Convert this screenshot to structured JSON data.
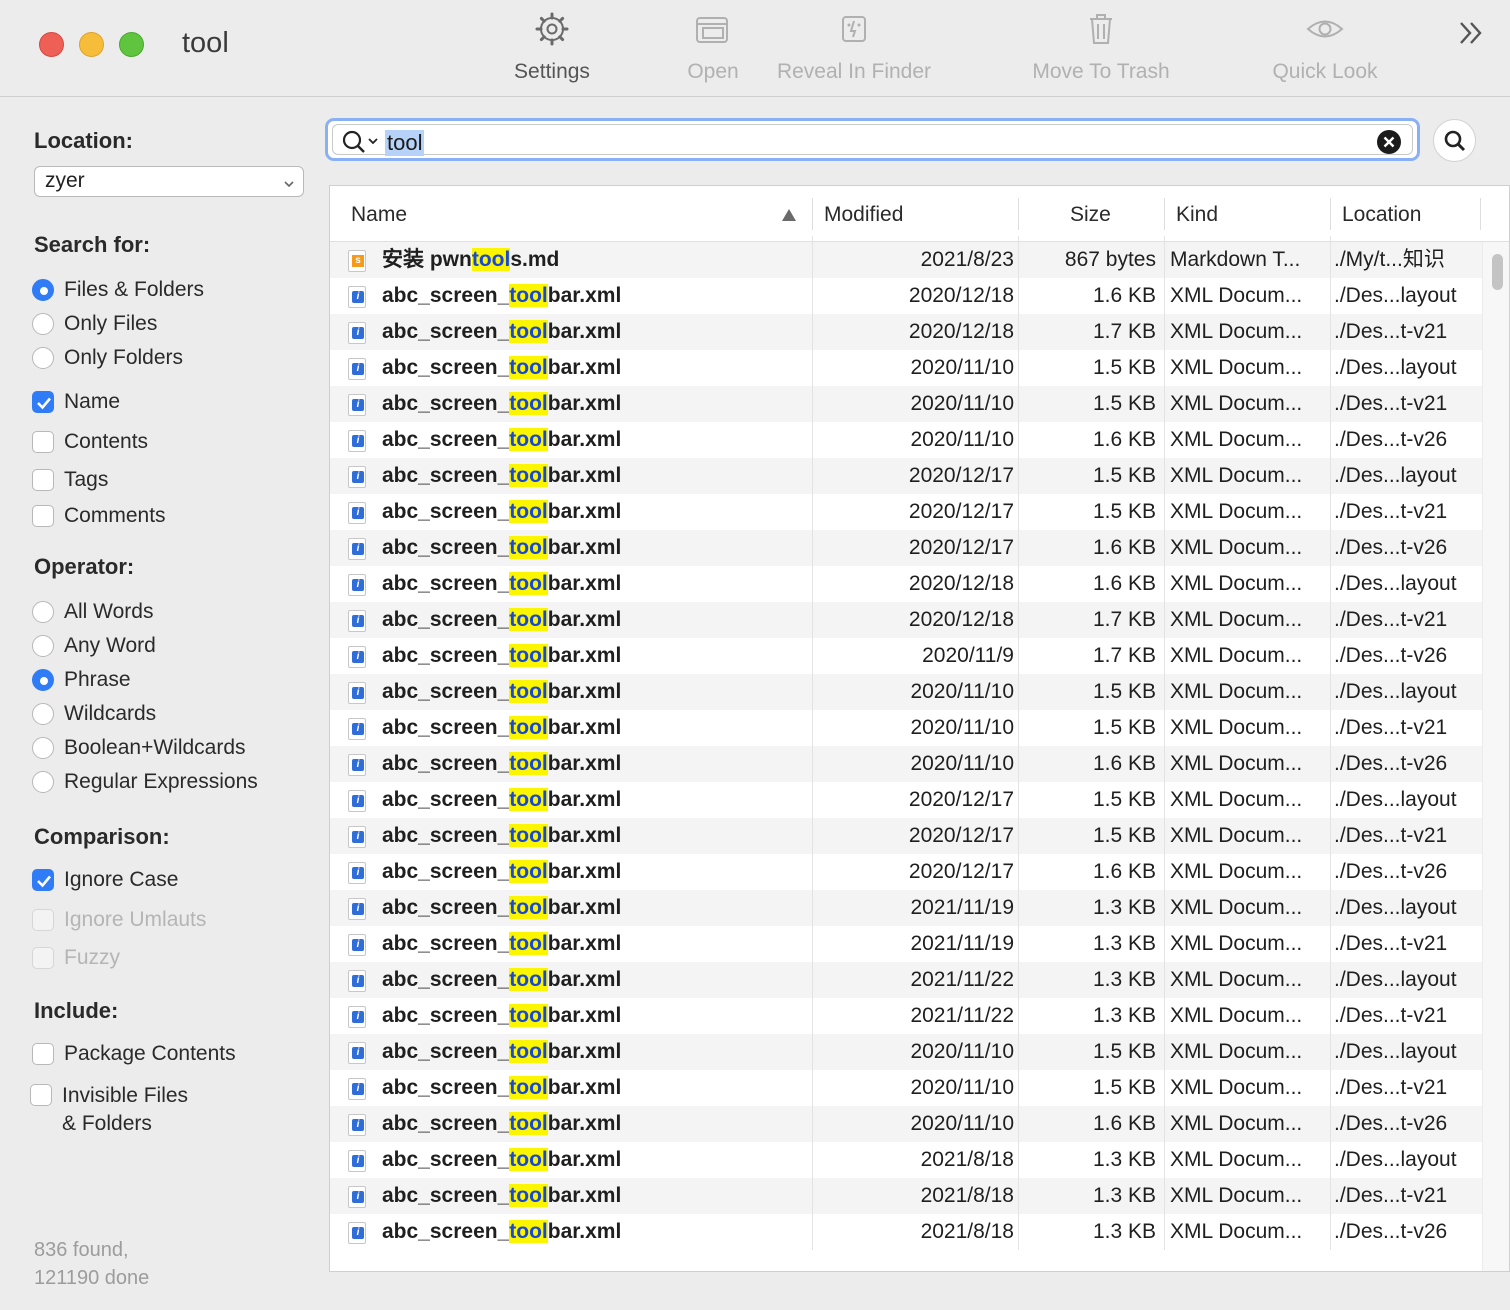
{
  "window": {
    "title": "tool"
  },
  "toolbar": {
    "settings": "Settings",
    "open": "Open",
    "reveal": "Reveal In Finder",
    "trash": "Move To Trash",
    "quicklook": "Quick Look"
  },
  "sidebar": {
    "location_heading": "Location:",
    "location_value": "zyer",
    "search_for_heading": "Search for:",
    "files_folders": "Files & Folders",
    "only_files": "Only Files",
    "only_folders": "Only Folders",
    "name": "Name",
    "contents": "Contents",
    "tags": "Tags",
    "comments": "Comments",
    "operator_heading": "Operator:",
    "all_words": "All Words",
    "any_word": "Any Word",
    "phrase": "Phrase",
    "wildcards": "Wildcards",
    "boolean_wildcards": "Boolean+Wildcards",
    "regex": "Regular Expressions",
    "comparison_heading": "Comparison:",
    "ignore_case": "Ignore Case",
    "ignore_umlauts": "Ignore Umlauts",
    "fuzzy": "Fuzzy",
    "include_heading": "Include:",
    "package_contents": "Package Contents",
    "invisible_line1": "Invisible Files",
    "invisible_line2": "& Folders",
    "status_found": "836 found,",
    "status_done": "121190 done"
  },
  "search": {
    "query": "tool"
  },
  "table": {
    "columns": {
      "name": "Name",
      "modified": "Modified",
      "size": "Size",
      "kind": "Kind",
      "location": "Location"
    },
    "first_row": {
      "pre": "安装 pwn",
      "hl": "tool",
      "post": "s.md",
      "modified": "2021/8/23",
      "size": "867 bytes",
      "kind": "Markdown T...",
      "location": "./My/t...知识"
    },
    "xml_name": {
      "pre": "abc_screen_",
      "hl": "tool",
      "post": "bar.xml"
    },
    "xml_kind": "XML Docum...",
    "rows": [
      {
        "modified": "2020/12/18",
        "size": "1.6 KB",
        "location": "./Des...layout"
      },
      {
        "modified": "2020/12/18",
        "size": "1.7 KB",
        "location": "./Des...t-v21"
      },
      {
        "modified": "2020/11/10",
        "size": "1.5 KB",
        "location": "./Des...layout"
      },
      {
        "modified": "2020/11/10",
        "size": "1.5 KB",
        "location": "./Des...t-v21"
      },
      {
        "modified": "2020/11/10",
        "size": "1.6 KB",
        "location": "./Des...t-v26"
      },
      {
        "modified": "2020/12/17",
        "size": "1.5 KB",
        "location": "./Des...layout"
      },
      {
        "modified": "2020/12/17",
        "size": "1.5 KB",
        "location": "./Des...t-v21"
      },
      {
        "modified": "2020/12/17",
        "size": "1.6 KB",
        "location": "./Des...t-v26"
      },
      {
        "modified": "2020/12/18",
        "size": "1.6 KB",
        "location": "./Des...layout"
      },
      {
        "modified": "2020/12/18",
        "size": "1.7 KB",
        "location": "./Des...t-v21"
      },
      {
        "modified": "2020/11/9",
        "size": "1.7 KB",
        "location": "./Des...t-v26"
      },
      {
        "modified": "2020/11/10",
        "size": "1.5 KB",
        "location": "./Des...layout"
      },
      {
        "modified": "2020/11/10",
        "size": "1.5 KB",
        "location": "./Des...t-v21"
      },
      {
        "modified": "2020/11/10",
        "size": "1.6 KB",
        "location": "./Des...t-v26"
      },
      {
        "modified": "2020/12/17",
        "size": "1.5 KB",
        "location": "./Des...layout"
      },
      {
        "modified": "2020/12/17",
        "size": "1.5 KB",
        "location": "./Des...t-v21"
      },
      {
        "modified": "2020/12/17",
        "size": "1.6 KB",
        "location": "./Des...t-v26"
      },
      {
        "modified": "2021/11/19",
        "size": "1.3 KB",
        "location": "./Des...layout"
      },
      {
        "modified": "2021/11/19",
        "size": "1.3 KB",
        "location": "./Des...t-v21"
      },
      {
        "modified": "2021/11/22",
        "size": "1.3 KB",
        "location": "./Des...layout"
      },
      {
        "modified": "2021/11/22",
        "size": "1.3 KB",
        "location": "./Des...t-v21"
      },
      {
        "modified": "2020/11/10",
        "size": "1.5 KB",
        "location": "./Des...layout"
      },
      {
        "modified": "2020/11/10",
        "size": "1.5 KB",
        "location": "./Des...t-v21"
      },
      {
        "modified": "2020/11/10",
        "size": "1.6 KB",
        "location": "./Des...t-v26"
      },
      {
        "modified": "2021/8/18",
        "size": "1.3 KB",
        "location": "./Des...layout"
      },
      {
        "modified": "2021/8/18",
        "size": "1.3 KB",
        "location": "./Des...t-v21"
      },
      {
        "modified": "2021/8/18",
        "size": "1.3 KB",
        "location": "./Des...t-v26"
      }
    ]
  },
  "colors": {
    "accent": "#2f7cf6",
    "highlight": "#fbf500",
    "highlight_text": "#1748d8"
  },
  "icons": {
    "settings": "gear-icon",
    "open": "window-icon",
    "reveal": "finder-icon",
    "trash": "trash-icon",
    "quicklook": "eye-icon",
    "more": "chevron-double-right-icon",
    "search": "magnifier-icon",
    "clear": "clear-circle-icon"
  }
}
